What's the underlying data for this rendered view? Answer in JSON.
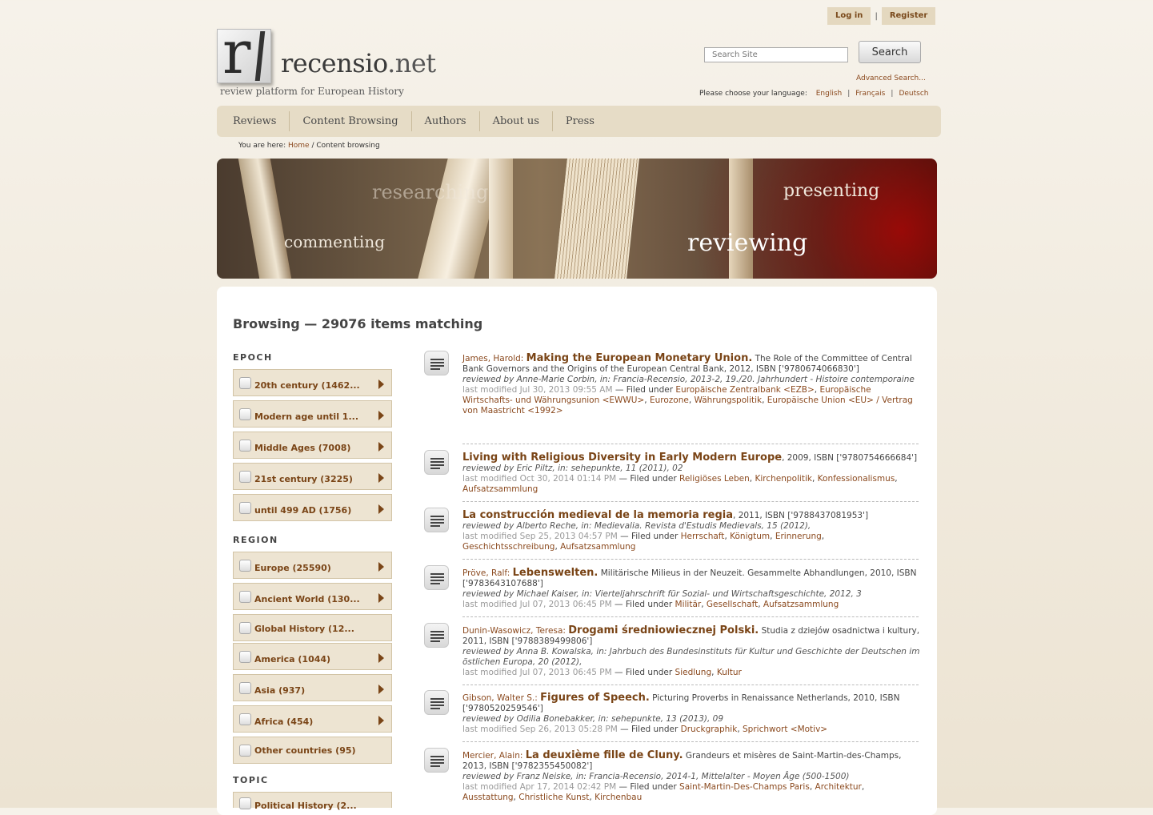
{
  "auth": {
    "login": "Log in",
    "sep": "|",
    "register": "Register"
  },
  "logo": {
    "letter": "r",
    "name": "recensio",
    "tld": ".net",
    "tagline": "review platform for European History"
  },
  "search": {
    "placeholder": "Search Site",
    "button": "Search",
    "advanced": "Advanced Search..."
  },
  "language": {
    "prompt": "Please choose your language:",
    "options": [
      "English",
      "Français",
      "Deutsch"
    ]
  },
  "nav": [
    "Reviews",
    "Content Browsing",
    "Authors",
    "About us",
    "Press"
  ],
  "breadcrumb": {
    "prefix": "You are here:",
    "home": "Home",
    "sep": "/",
    "current": "Content browsing"
  },
  "banner": {
    "words": [
      "researching",
      "presenting",
      "commenting",
      "reviewing"
    ]
  },
  "heading": "Browsing — 29076 items matching",
  "sidebar": {
    "epoch_title": "EPOCH",
    "epoch": [
      "20th century (1462...",
      "Modern age until 1...",
      "Middle Ages (7008)",
      "21st century (3225)",
      "until 499 AD (1756)"
    ],
    "region_title": "REGION",
    "region": [
      "Europe (25590)",
      "Ancient World (130...",
      "Global History (12...",
      "America (1044)",
      "Asia (937)",
      "Africa (454)",
      "Other countries (95)"
    ],
    "topic_title": "TOPIC",
    "topic": [
      "Political History (2..."
    ]
  },
  "results": [
    {
      "author": "James, Harold:",
      "title": "Making the European Monetary Union.",
      "details": " The Role of the Committee of Central Bank Governors and the Origins of the European Central Bank, 2012, ISBN ['9780674066830']",
      "reviewed": "reviewed by Anne-Marie Corbin, in: Francia-Recensio, 2013-2, 19./20. Jahrhundert - Histoire contemporaine",
      "modified": "last modified Jul 30, 2013 09:55 AM",
      "filed": " — Filed under ",
      "tags": [
        "Europäische Zentralbank <EZB>",
        "Europäische Wirtschafts- und Währungsunion <EWWU>",
        "Eurozone",
        "Währungspolitik",
        "Europäische Union <EU> / Vertrag von Maastricht <1992>"
      ]
    },
    {
      "author": "",
      "title": "Living with Religious Diversity in Early Modern Europe",
      "details": ", 2009, ISBN ['9780754666684']",
      "reviewed": "reviewed by Eric Piltz, in: sehepunkte, 11 (2011), 02",
      "modified": "last modified Oct 30, 2014 01:14 PM",
      "filed": " — Filed under ",
      "tags": [
        "Religiöses Leben",
        "Kirchenpolitik",
        "Konfessionalismus",
        "Aufsatzsammlung"
      ]
    },
    {
      "author": "",
      "title": "La construcción medieval de la memoria regia",
      "details": ", 2011, ISBN ['9788437081953']",
      "reviewed": "reviewed by Alberto Reche, in: Medievalia. Revista d'Estudis Medievals, 15 (2012),",
      "modified": "last modified Sep 25, 2013 04:57 PM",
      "filed": " — Filed under ",
      "tags": [
        "Herrschaft",
        "Königtum",
        "Erinnerung",
        "Geschichtsschreibung",
        "Aufsatzsammlung"
      ]
    },
    {
      "author": "Pröve, Ralf:",
      "title": "Lebenswelten.",
      "details": " Militärische Milieus in der Neuzeit. Gesammelte Abhandlungen, 2010, ISBN ['9783643107688']",
      "reviewed": "reviewed by Michael Kaiser, in: Vierteljahrschrift für Sozial- und Wirtschaftsgeschichte, 2012, 3",
      "modified": "last modified Jul 07, 2013 06:45 PM",
      "filed": " — Filed under ",
      "tags": [
        "Militär",
        "Gesellschaft",
        "Aufsatzsammlung"
      ]
    },
    {
      "author": "Dunin-Wasowicz, Teresa:",
      "title": "Drogami średniowiecznej Polski.",
      "details": " Studia z dziejów osadnictwa i kultury, 2011, ISBN ['9788389499806']",
      "reviewed": "reviewed by Anna B. Kowalska, in: Jahrbuch des Bundesinstituts für Kultur und Geschichte der Deutschen im östlichen Europa, 20 (2012),",
      "modified": "last modified Jul 07, 2013 06:45 PM",
      "filed": " — Filed under ",
      "tags": [
        "Siedlung",
        "Kultur"
      ]
    },
    {
      "author": "Gibson, Walter S.:",
      "title": "Figures of Speech.",
      "details": " Picturing Proverbs in Renaissance Netherlands, 2010, ISBN ['9780520259546']",
      "reviewed": "reviewed by Odilia Bonebakker, in: sehepunkte, 13 (2013), 09",
      "modified": "last modified Sep 26, 2013 05:28 PM",
      "filed": " — Filed under ",
      "tags": [
        "Druckgraphik",
        "Sprichwort <Motiv>"
      ]
    },
    {
      "author": "Mercier, Alain:",
      "title": "La deuxième fille de Cluny.",
      "details": " Grandeurs et misères de Saint-Martin-des-Champs, 2013, ISBN ['9782355450082']",
      "reviewed": "reviewed by Franz Neiske, in: Francia-Recensio, 2014-1, Mittelalter - Moyen Âge (500-1500)",
      "modified": "last modified Apr 17, 2014 02:42 PM",
      "filed": " — Filed under ",
      "tags": [
        "Saint-Martin-Des-Champs Paris",
        "Architektur",
        "Ausstattung",
        "Christliche Kunst",
        "Kirchenbau"
      ]
    }
  ],
  "colors": {
    "accent": "#8b4a1f",
    "facet_bg": "#ede4d2",
    "nav_bg": "#e6dcc6"
  }
}
